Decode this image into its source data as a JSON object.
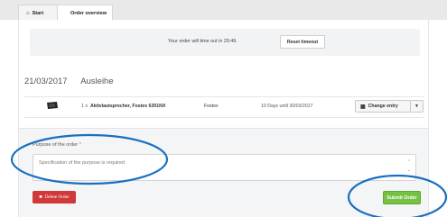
{
  "tabs": [
    {
      "label": "Start",
      "icon": "home-icon"
    },
    {
      "label": "Order overview"
    }
  ],
  "timeout": {
    "message": "Your order will time out in 29:49.",
    "reset_label": "Reset timeout"
  },
  "order_group": {
    "date": "21/03/2017",
    "label": "Ausleihe"
  },
  "items": [
    {
      "icon": "speaker-icon",
      "quantity": "1 x",
      "name": "Aktivlautsprecher, Fostex 6301NX",
      "brand": "Fostex",
      "period": "10 Days until 30/03/2017",
      "change_label": "Change entry"
    }
  ],
  "purpose": {
    "label": "Purpose of the order",
    "required_mark": "*",
    "placeholder": "Specification of the purpose is required"
  },
  "actions": {
    "delete_label": "Delete Order",
    "submit_label": "Submit Order"
  },
  "colors": {
    "delete": "#d0383a",
    "submit": "#76c043",
    "annotation_ellipse": "#1a6fc0"
  }
}
